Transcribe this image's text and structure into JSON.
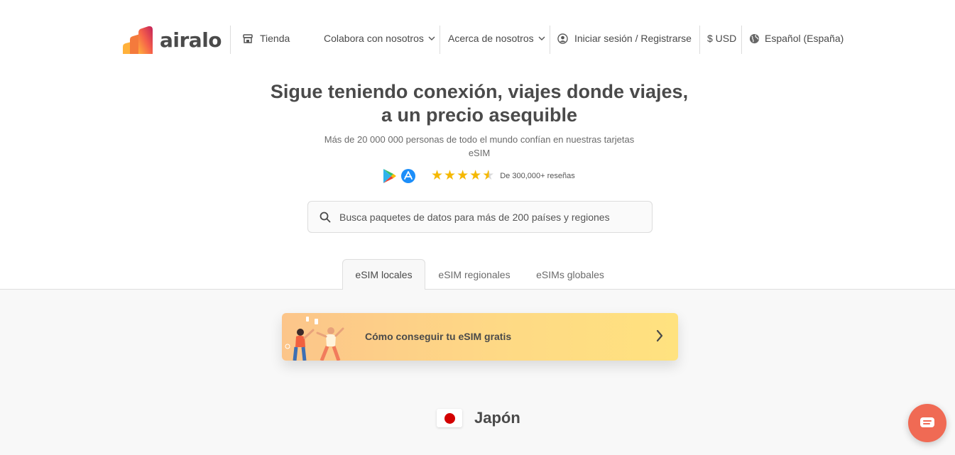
{
  "brand": {
    "name": "airalo"
  },
  "nav": {
    "store": "Tienda",
    "partner": "Colabora con nosotros",
    "about": "Acerca de nosotros",
    "login": "Iniciar sesión / Registrarse",
    "currency": "$ USD",
    "language": "Español (España)"
  },
  "hero": {
    "title": "Sigue teniendo conexión, viajes donde viajes, a un precio asequible",
    "subtitle": "Más de 20 000 000 personas de todo el mundo confían en nuestras tarjetas eSIM",
    "rating": 4.5,
    "reviews": "De 300,000+ reseñas"
  },
  "search": {
    "placeholder": "Busca paquetes de datos para más de 200 países y regiones"
  },
  "tabs": [
    {
      "label": "eSIM locales",
      "active": true
    },
    {
      "label": "eSIM regionales",
      "active": false
    },
    {
      "label": "eSIMs globales",
      "active": false
    }
  ],
  "banner": {
    "text": "Cómo conseguir tu eSIM gratis"
  },
  "country": {
    "name": "Japón"
  },
  "colors": {
    "accent": "#f06a54",
    "star": "#f5b800",
    "text": "#4a4a4a"
  },
  "icons": [
    "store-icon",
    "chevron-down-icon",
    "user-icon",
    "globe-icon",
    "google-play-icon",
    "app-store-icon",
    "search-icon",
    "chevron-right-icon",
    "chat-icon"
  ]
}
